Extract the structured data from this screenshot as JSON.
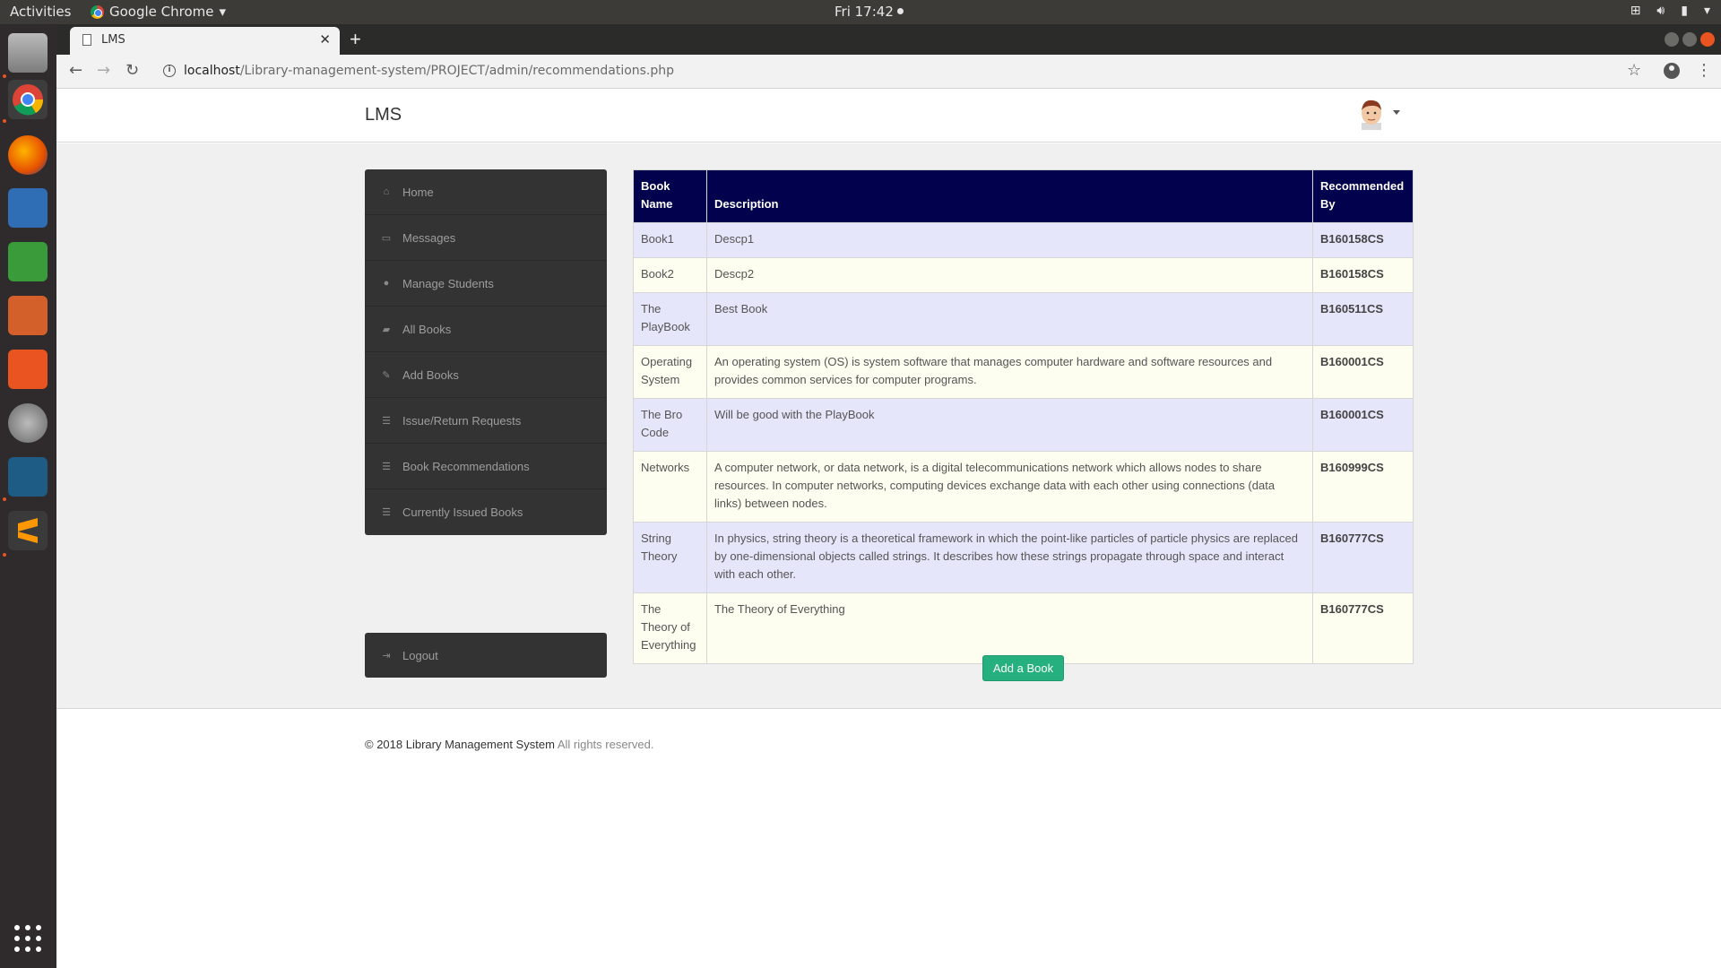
{
  "topbar": {
    "activities": "Activities",
    "app_name": "Google Chrome",
    "clock": "Fri 17:42"
  },
  "browser": {
    "tab_title": "LMS",
    "url_host": "localhost",
    "url_path": "/Library-management-system/PROJECT/admin/recommendations.php"
  },
  "navbar": {
    "brand": "LMS"
  },
  "sidebar": {
    "items": [
      {
        "label": "Home",
        "icon": "home-icon"
      },
      {
        "label": "Messages",
        "icon": "inbox-icon"
      },
      {
        "label": "Manage Students",
        "icon": "user-icon"
      },
      {
        "label": "All Books",
        "icon": "book-icon"
      },
      {
        "label": "Add Books",
        "icon": "edit-icon"
      },
      {
        "label": "Issue/Return Requests",
        "icon": "list-icon"
      },
      {
        "label": "Book Recommendations",
        "icon": "list-icon"
      },
      {
        "label": "Currently Issued Books",
        "icon": "list-icon"
      }
    ],
    "logout": "Logout"
  },
  "table": {
    "headers": [
      "Book Name",
      "Description",
      "Recommended By"
    ],
    "rows": [
      {
        "name": "Book1",
        "description": "Descp1",
        "by": "B160158CS"
      },
      {
        "name": "Book2",
        "description": "Descp2",
        "by": "B160158CS"
      },
      {
        "name": "The PlayBook",
        "description": "Best Book",
        "by": "B160511CS"
      },
      {
        "name": "Operating System",
        "description": "An operating system (OS) is system software that manages computer hardware and software resources and provides common services for computer programs.",
        "by": "B160001CS"
      },
      {
        "name": "The Bro Code",
        "description": "Will be good with the PlayBook",
        "by": "B160001CS"
      },
      {
        "name": "Networks",
        "description": "A computer network, or data network, is a digital telecommunications network which allows nodes to share resources. In computer networks, computing devices exchange data with each other using connections (data links) between nodes.",
        "by": "B160999CS"
      },
      {
        "name": "String Theory",
        "description": "In physics, string theory is a theoretical framework in which the point-like particles of particle physics are replaced by one-dimensional objects called strings. It describes how these strings propagate through space and interact with each other.",
        "by": "B160777CS"
      },
      {
        "name": "The Theory of Everything",
        "description": "The Theory of Everything",
        "by": "B160777CS"
      }
    ]
  },
  "add_button": "Add a Book",
  "footer": {
    "copyright": "© 2018 Library Management System",
    "rights": "All rights reserved."
  }
}
